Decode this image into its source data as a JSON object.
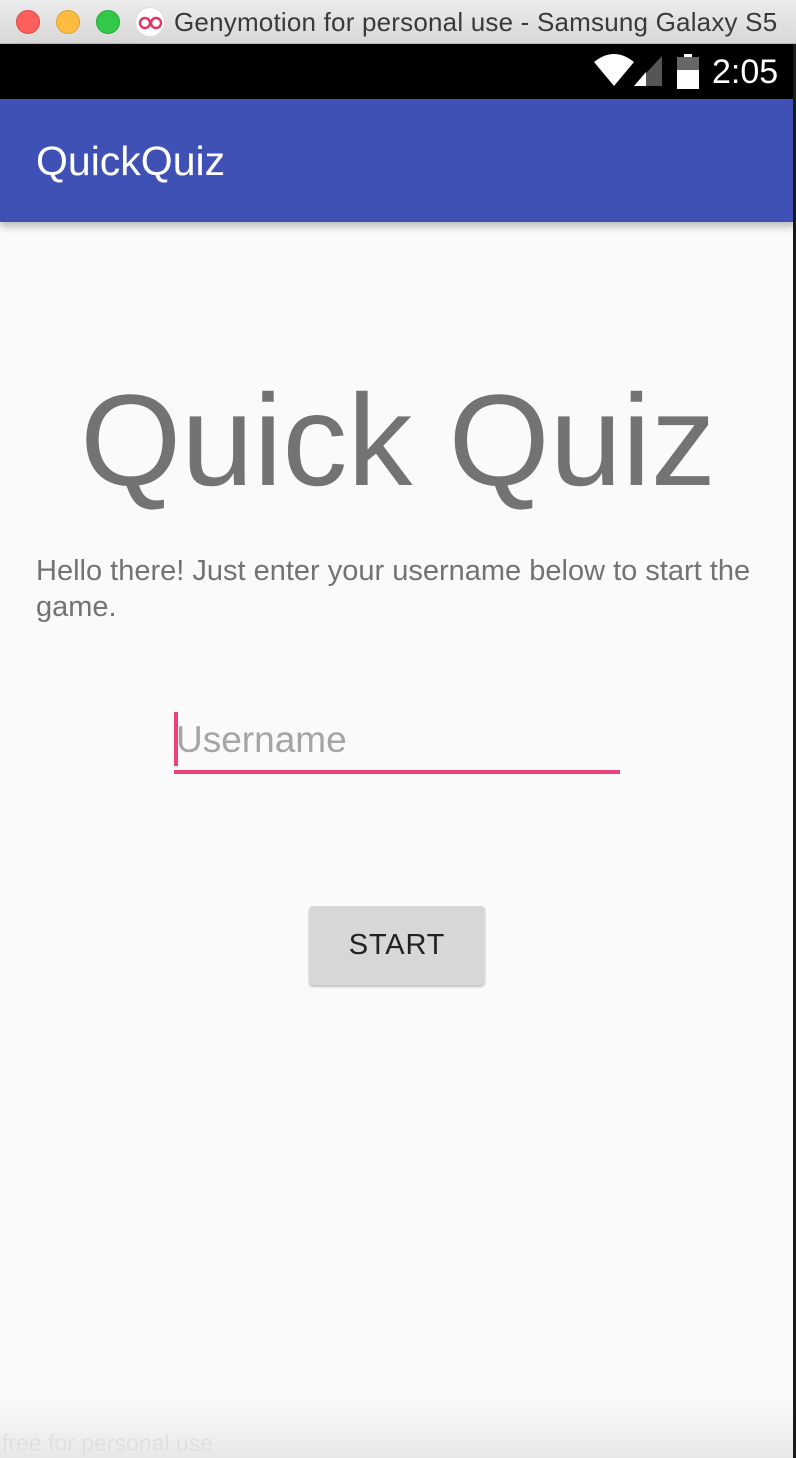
{
  "window": {
    "title": "Genymotion for personal use - Samsung Galaxy S5",
    "watermark": "free for personal use",
    "icons": [
      "close-icon",
      "minimize-icon",
      "maximize-icon",
      "genymotion-logo-icon"
    ]
  },
  "status_bar": {
    "time": "2:05",
    "icons": [
      "wifi-icon",
      "cell-signal-icon",
      "battery-icon"
    ]
  },
  "app_bar": {
    "title": "QuickQuiz",
    "color": "#3f51b5"
  },
  "main": {
    "heading": "Quick Quiz",
    "intro": "Hello there! Just enter your username below to start the game.",
    "username_placeholder": "Username",
    "username_value": "",
    "start_label": "START",
    "accent_color": "#ec407a"
  }
}
